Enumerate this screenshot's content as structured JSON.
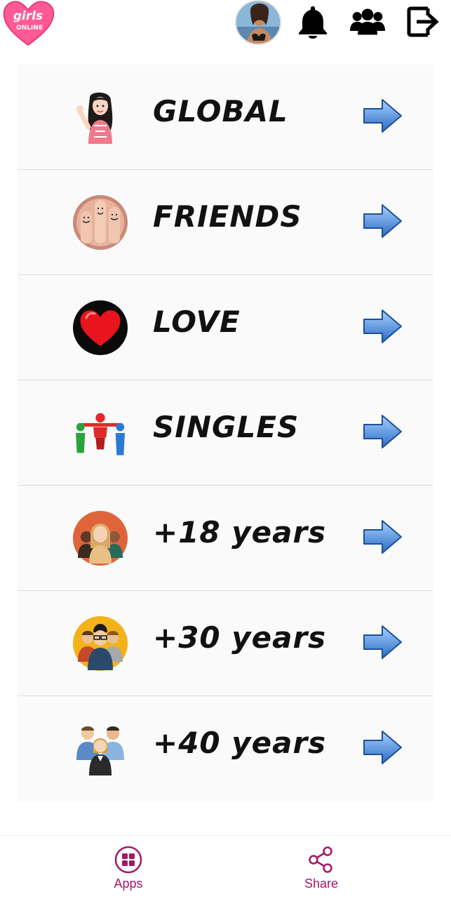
{
  "header": {
    "logo_text": "girls ONLINE",
    "icons": [
      "notification-bell-icon",
      "people-group-icon",
      "logout-icon"
    ]
  },
  "rooms": [
    {
      "label": "GLOBAL",
      "icon": "waving-girl-icon"
    },
    {
      "label": "FRIENDS",
      "icon": "smiling-fingers-icon"
    },
    {
      "label": "LOVE",
      "icon": "red-heart-icon"
    },
    {
      "label": "SINGLES",
      "icon": "people-hugging-icon"
    },
    {
      "label": "+18 years",
      "icon": "young-people-icon"
    },
    {
      "label": "+30 years",
      "icon": "adult-people-icon"
    },
    {
      "label": "+40 years",
      "icon": "business-people-icon"
    }
  ],
  "nav": {
    "apps_label": "Apps",
    "share_label": "Share"
  },
  "colors": {
    "accent": "#a0186a",
    "arrow": "#3a78c9",
    "logo_pink": "#ff4f8f"
  }
}
